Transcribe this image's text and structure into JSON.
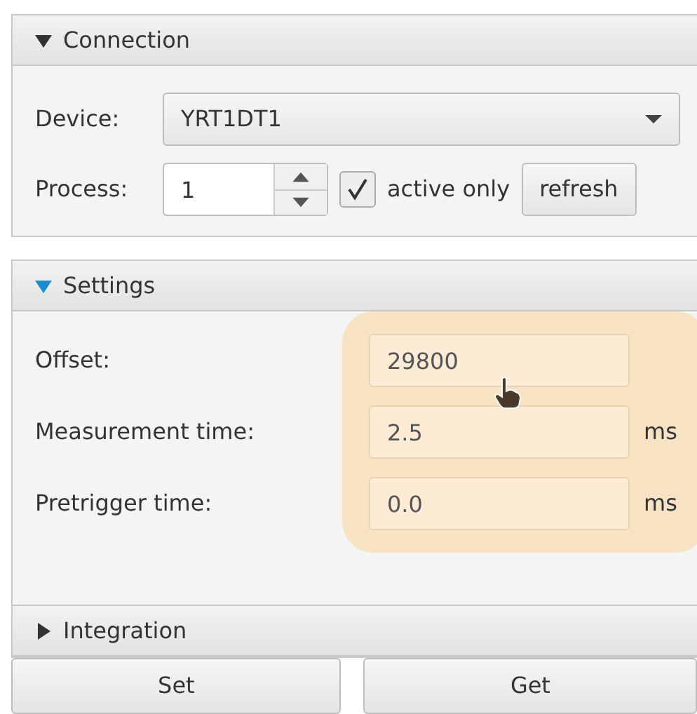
{
  "panels": [
    {
      "kind": "connection",
      "title": "Connection",
      "expanded": true,
      "focused": false,
      "device": {
        "label": "Device:",
        "value": "YRT1DT1"
      },
      "process": {
        "label": "Process:",
        "value": "1"
      },
      "active_only": {
        "label": "active only",
        "checked": true
      },
      "refresh": "refresh"
    },
    {
      "kind": "settings",
      "title": "Settings",
      "expanded": true,
      "focused": true,
      "highlighted": true,
      "fields": [
        {
          "label": "Offset:",
          "value": "29800"
        },
        {
          "label": "Measurement time:",
          "value": "2.5",
          "unit": "ms"
        },
        {
          "label": "Pretrigger time:",
          "value": "0.0",
          "unit": "ms"
        }
      ]
    },
    {
      "kind": "integration",
      "title": "Integration",
      "expanded": false,
      "focused": false
    }
  ],
  "buttons": [
    "Set",
    "Get"
  ]
}
